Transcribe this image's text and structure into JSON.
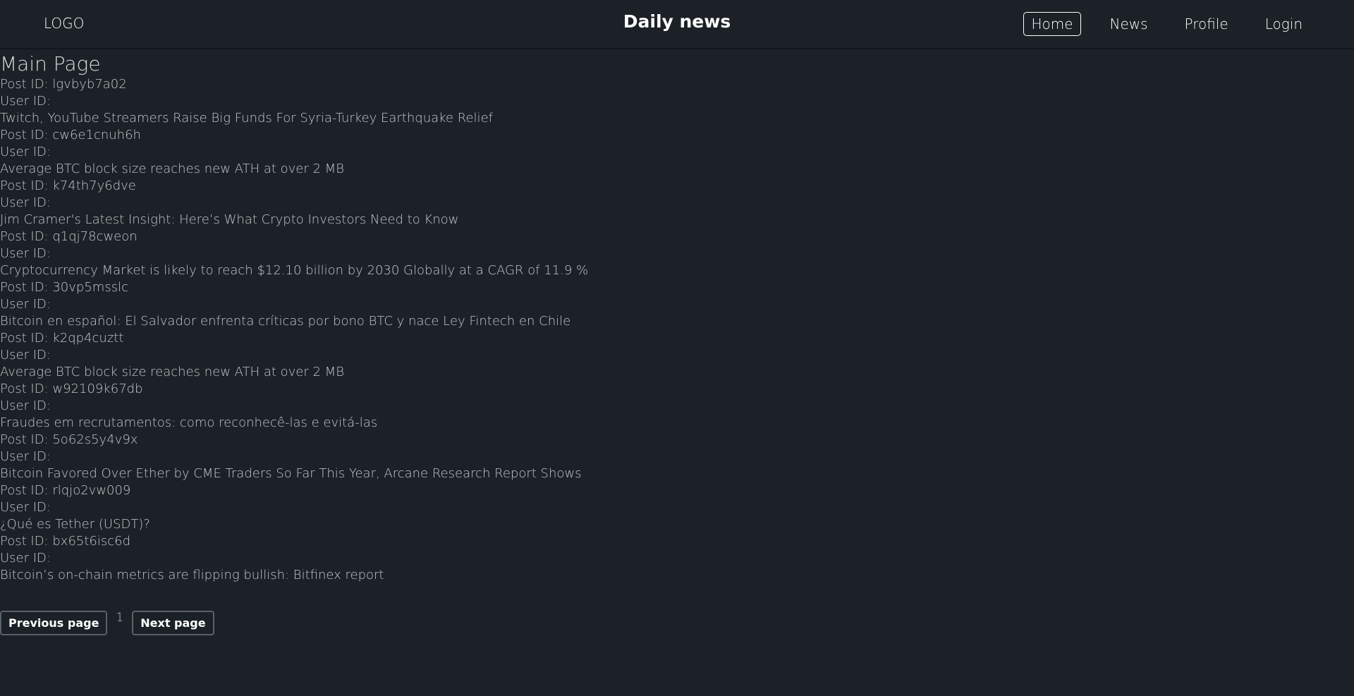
{
  "header": {
    "logo": "LOGO",
    "title": "Daily news",
    "nav": [
      "Home",
      "News",
      "Profile",
      "Login"
    ],
    "active": "Home"
  },
  "main": {
    "heading": "Main Page",
    "post_id_label": "Post ID:",
    "user_id_label": "User ID:",
    "posts": [
      {
        "id": "lgvbyb7a02",
        "user": "",
        "title": "Twitch, YouTube Streamers Raise Big Funds For Syria-Turkey Earthquake Relief"
      },
      {
        "id": "cw6e1cnuh6h",
        "user": "",
        "title": "Average BTC block size reaches new ATH at over 2 MB"
      },
      {
        "id": "k74th7y6dve",
        "user": "",
        "title": "Jim Cramer's Latest Insight: Here’s What Crypto Investors Need to Know"
      },
      {
        "id": "q1qj78cweon",
        "user": "",
        "title": "Cryptocurrency Market is likely to reach $12.10 billion by 2030 Globally at a CAGR of 11.9 %"
      },
      {
        "id": "30vp5msslc",
        "user": "",
        "title": "Bitcoin en español: El Salvador enfrenta críticas por bono BTC y nace Ley Fintech en Chile"
      },
      {
        "id": "k2qp4cuztt",
        "user": "",
        "title": "Average BTC block size reaches new ATH at over 2 MB"
      },
      {
        "id": "w92109k67db",
        "user": "",
        "title": "Fraudes em recrutamentos: como reconhecê-las e evitá-las"
      },
      {
        "id": "5o62s5y4v9x",
        "user": "",
        "title": "Bitcoin Favored Over Ether by CME Traders So Far This Year, Arcane Research Report Shows"
      },
      {
        "id": "rlqjo2vw009",
        "user": "",
        "title": "¿Qué es Tether (USDT)?"
      },
      {
        "id": "bx65t6isc6d",
        "user": "",
        "title": "Bitcoin’s on-chain metrics are flipping bullish: Bitfinex report"
      }
    ]
  },
  "pagination": {
    "prev_label": "Previous page",
    "page": "1",
    "next_label": "Next page"
  }
}
